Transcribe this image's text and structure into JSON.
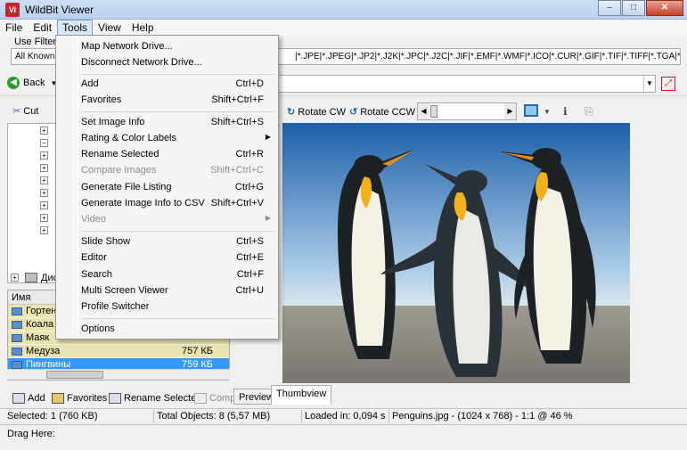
{
  "window": {
    "title": "WildBit Viewer",
    "app_icon": "Vi"
  },
  "menubar": [
    "File",
    "Edit",
    "Tools",
    "View",
    "Help"
  ],
  "filter": {
    "label": "Use Filter",
    "value_prefix": "All Known",
    "value_ext": "|*.JPE|*.JPEG|*.JP2|*.J2K|*.JPC|*.J2C|*.JIF|*.EMF|*.WMF|*.ICO|*.CUR|*.GIF|*.TIF|*.TIFF|*.TGA|*.TARG"
  },
  "nav": {
    "back_label": "Back"
  },
  "toolbar": {
    "cut_label": "Cut",
    "rotate_cw": "Rotate CW",
    "rotate_ccw": "Rotate CCW"
  },
  "tree": {
    "drive_label": "Дис"
  },
  "file_list": {
    "header": "Имя",
    "rows": [
      {
        "name": "Гортен",
        "size": ""
      },
      {
        "name": "Коала",
        "size": ""
      },
      {
        "name": "Маяк",
        "size": ""
      },
      {
        "name": "Медуза",
        "size": "757 КБ"
      },
      {
        "name": "Пингвины",
        "size": "759 КБ",
        "selected": true
      }
    ]
  },
  "bottom_actions": {
    "add": "Add",
    "favorites": "Favorites",
    "rename": "Rename Selected",
    "compare": "Comp"
  },
  "view_tabs": {
    "preview": "Preview",
    "thumbview": "Thumbview"
  },
  "status": {
    "selected": "Selected: 1 (760 KB)",
    "total": "Total Objects: 8 (5,57 MB)",
    "loaded": "Loaded in: 0,094 s",
    "file_info": "Penguins.jpg -  (1024 x 768) - 1:1 @ 46  %",
    "drag": "Drag Here:"
  },
  "tools_menu": {
    "items": [
      {
        "label": "Map Network Drive...",
        "shortcut": "",
        "enabled": true
      },
      {
        "label": "Disconnect Network Drive...",
        "shortcut": "",
        "enabled": true
      },
      {
        "label": "Add",
        "shortcut": "Ctrl+D",
        "enabled": true
      },
      {
        "label": "Favorites",
        "shortcut": "Shift+Ctrl+F",
        "enabled": true
      },
      {
        "label": "Set Image Info",
        "shortcut": "Shift+Ctrl+S",
        "enabled": true
      },
      {
        "label": "Rating & Color Labels",
        "shortcut": "",
        "enabled": true,
        "submenu": true
      },
      {
        "label": "Rename Selected",
        "shortcut": "Ctrl+R",
        "enabled": true
      },
      {
        "label": "Compare Images",
        "shortcut": "Shift+Ctrl+C",
        "enabled": false
      },
      {
        "label": "Generate File Listing",
        "shortcut": "Ctrl+G",
        "enabled": true
      },
      {
        "label": "Generate Image Info to CSV",
        "shortcut": "Shift+Ctrl+V",
        "enabled": true
      },
      {
        "label": "Video",
        "shortcut": "",
        "enabled": false,
        "submenu": true
      },
      {
        "label": "Slide Show",
        "shortcut": "Ctrl+S",
        "enabled": true
      },
      {
        "label": "Editor",
        "shortcut": "Ctrl+E",
        "enabled": true
      },
      {
        "label": "Search",
        "shortcut": "Ctrl+F",
        "enabled": true
      },
      {
        "label": "Multi Screen Viewer",
        "shortcut": "Ctrl+U",
        "enabled": true
      },
      {
        "label": "Profile Switcher",
        "shortcut": "",
        "enabled": true
      },
      {
        "label": "Options",
        "shortcut": "",
        "enabled": true
      }
    ]
  },
  "colors": {
    "selection": "#3399ff",
    "list_highlight": "#e9e3b0",
    "accent": "#2a6aa8"
  }
}
